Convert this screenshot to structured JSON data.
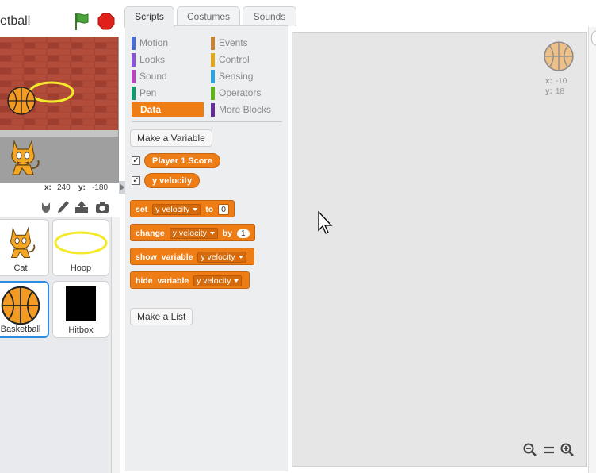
{
  "project": {
    "title": "etball"
  },
  "stage": {
    "coords": {
      "x_label": "x:",
      "x_value": "240",
      "y_label": "y:",
      "y_value": "-180"
    }
  },
  "sprites": [
    {
      "name": "Cat",
      "selected": false
    },
    {
      "name": "Hoop",
      "selected": false
    },
    {
      "name": "Basketball",
      "selected": true
    },
    {
      "name": "Hitbox",
      "selected": false
    }
  ],
  "tabs": [
    {
      "label": "Scripts",
      "active": true
    },
    {
      "label": "Costumes",
      "active": false
    },
    {
      "label": "Sounds",
      "active": false
    }
  ],
  "categories": [
    {
      "label": "Motion",
      "color": "#4a6cd4"
    },
    {
      "label": "Looks",
      "color": "#8a55d7"
    },
    {
      "label": "Sound",
      "color": "#bb42c3"
    },
    {
      "label": "Pen",
      "color": "#0e9a6c"
    },
    {
      "label": "Data",
      "color": "#ee7d16",
      "active": true
    },
    {
      "label": "Events",
      "color": "#c88330"
    },
    {
      "label": "Control",
      "color": "#e1a91a"
    },
    {
      "label": "Sensing",
      "color": "#2ca5e2"
    },
    {
      "label": "Operators",
      "color": "#5cb712"
    },
    {
      "label": "More Blocks",
      "color": "#632d99"
    }
  ],
  "palette": {
    "make_variable": "Make a Variable",
    "make_list": "Make a List",
    "variables": [
      {
        "name": "Player 1 Score",
        "checked": true
      },
      {
        "name": "y velocity",
        "checked": true
      }
    ],
    "blocks": {
      "set": {
        "kw": "set",
        "var": "y velocity",
        "kw2": "to",
        "value": "0"
      },
      "change": {
        "kw": "change",
        "var": "y velocity",
        "kw2": "by",
        "value": "1"
      },
      "show": {
        "kw": "show",
        "kw2": "variable",
        "var": "y velocity"
      },
      "hide": {
        "kw": "hide",
        "kw2": "variable",
        "var": "y velocity"
      }
    }
  },
  "scripts_area": {
    "sprite_x_label": "x:",
    "sprite_x": "-10",
    "sprite_y_label": "y:",
    "sprite_y": "18"
  },
  "colors": {
    "data_orange": "#ee7d16",
    "selected_blue": "#2d8be0"
  },
  "icons": [
    "green-flag-icon",
    "stop-icon",
    "paint-sprite-icon",
    "brush-icon",
    "upload-icon",
    "camera-icon",
    "zoom-out-icon",
    "zoom-reset-icon",
    "zoom-in-icon",
    "mouse-cursor-icon"
  ]
}
